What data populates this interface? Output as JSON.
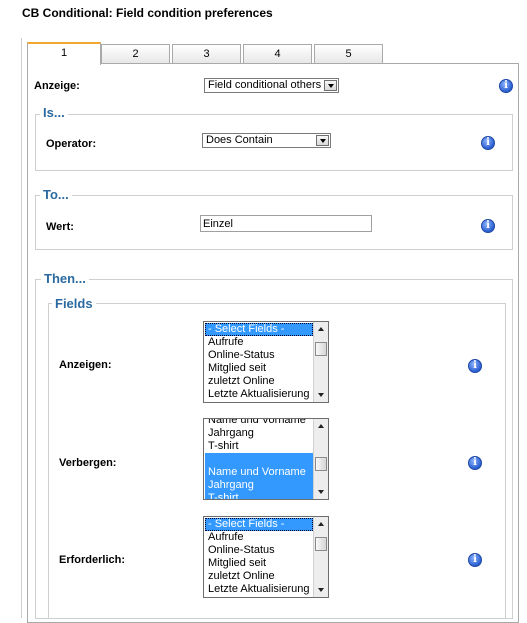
{
  "page_title": "CB Conditional: Field condition preferences",
  "tabs": [
    {
      "label": "1",
      "active": true
    },
    {
      "label": "2",
      "active": false
    },
    {
      "label": "3",
      "active": false
    },
    {
      "label": "4",
      "active": false
    },
    {
      "label": "5",
      "active": false
    }
  ],
  "anzeige": {
    "label": "Anzeige:",
    "value": "Field conditional others"
  },
  "is_section": {
    "legend": "Is...",
    "operator_label": "Operator:",
    "operator_value": "Does Contain"
  },
  "to_section": {
    "legend": "To...",
    "wert_label": "Wert:",
    "wert_value": "Einzel"
  },
  "then_section": {
    "legend": "Then...",
    "fields_legend": "Fields",
    "anzeigen": {
      "label": "Anzeigen:",
      "options": [
        "- Select Fields -",
        "Aufrufe",
        "Online-Status",
        "Mitglied seit",
        "zuletzt Online",
        "Letzte Aktualisierung"
      ],
      "selected": [
        "- Select Fields -"
      ]
    },
    "verbergen": {
      "label": "Verbergen:",
      "options": [
        "Name und Vorname",
        "Jahrgang",
        "T-shirt",
        "",
        "Name und Vorname",
        "Jahrgang",
        "T-shirt"
      ],
      "selected_indexes": [
        3,
        4,
        5,
        6
      ]
    },
    "erforderlich": {
      "label": "Erforderlich:",
      "options": [
        "- Select Fields -",
        "Aufrufe",
        "Online-Status",
        "Mitglied seit",
        "zuletzt Online",
        "Letzte Aktualisierung"
      ],
      "selected": [
        "- Select Fields -"
      ]
    }
  },
  "icons": {
    "info": "info-icon",
    "dropdown": "chevron-down-icon"
  },
  "colors": {
    "legend": "#2b6aa0",
    "selection": "#3399ff",
    "active_tab_border": "#f0a830"
  }
}
